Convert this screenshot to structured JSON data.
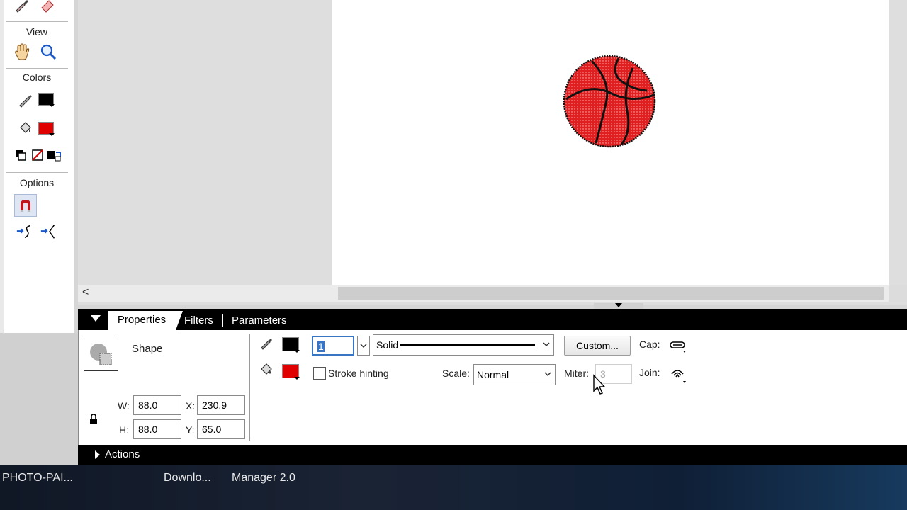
{
  "tools_panel": {
    "view_heading": "View",
    "colors_heading": "Colors",
    "options_heading": "Options",
    "icons": [
      "eyedropper-icon",
      "eraser-icon",
      "hand-icon",
      "zoom-icon",
      "pencil-stroke-icon",
      "paint-bucket-icon",
      "black-white-icon",
      "no-color-icon",
      "swap-colors-icon",
      "snap-magnet-icon",
      "smooth-icon",
      "straighten-icon"
    ],
    "stroke_color": "#000000",
    "fill_color": "#e00000"
  },
  "stage": {
    "ball_color": "#e02020",
    "scroll_left_glyph": "<"
  },
  "panel": {
    "tabs": {
      "properties": "Properties",
      "filters": "Filters",
      "parameters": "Parameters"
    },
    "shape_label": "Shape",
    "stroke_color": "#000000",
    "fill_color": "#e00000",
    "stroke_height_value": "1",
    "stroke_style_value": "Solid",
    "custom_button": "Custom...",
    "cap_label": "Cap:",
    "stroke_hinting_label": "Stroke hinting",
    "scale_label": "Scale:",
    "scale_value": "Normal",
    "miter_label": "Miter:",
    "miter_value": "3",
    "join_label": "Join:",
    "w_label": "W:",
    "w_value": "88.0",
    "h_label": "H:",
    "h_value": "88.0",
    "x_label": "X:",
    "x_value": "230.9",
    "y_label": "Y:",
    "y_value": "65.0",
    "actions_label": "Actions"
  },
  "taskbar": {
    "items": [
      "PHOTO-PAI...",
      "Downlo...",
      "Manager 2.0"
    ]
  }
}
